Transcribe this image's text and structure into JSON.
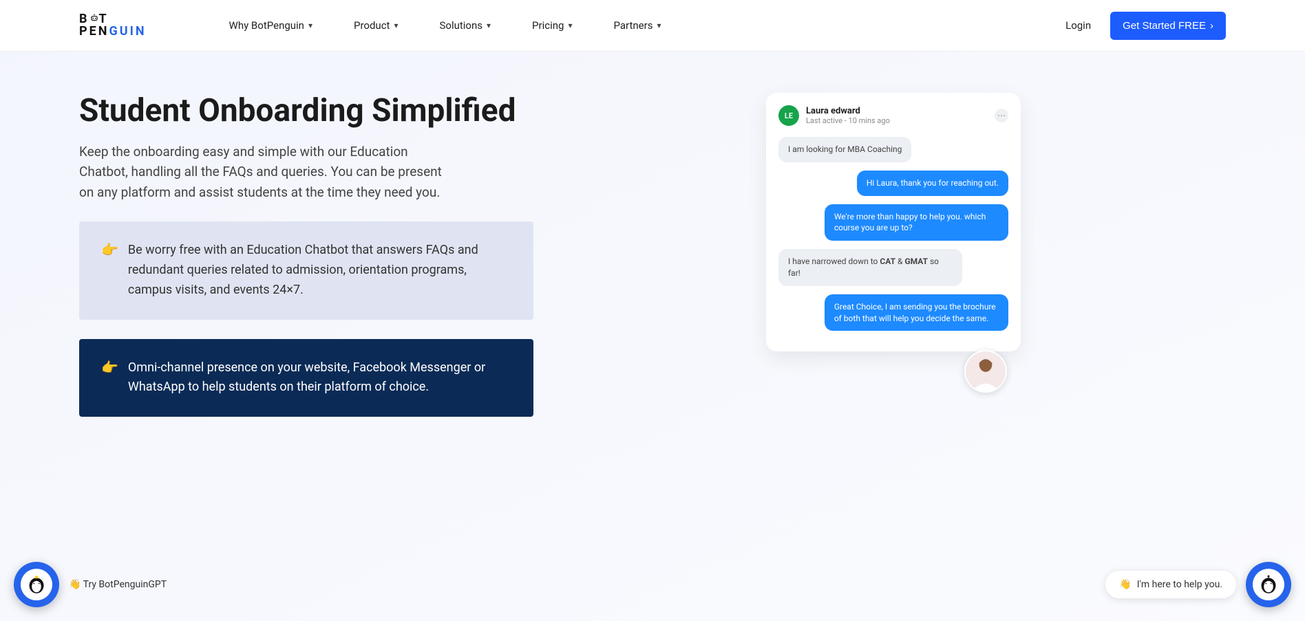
{
  "logo": {
    "line1": "B",
    "line1_end": "T",
    "line2a": "PEN",
    "line2b": "GUIN"
  },
  "nav": {
    "why": "Why BotPenguin",
    "product": "Product",
    "solutions": "Solutions",
    "pricing": "Pricing",
    "partners": "Partners"
  },
  "login": "Login",
  "cta": "Get Started FREE",
  "hero": {
    "title": "Student Onboarding Simplified",
    "subtitle": "Keep the onboarding easy and simple with our Education Chatbot, handling all the FAQs and queries. You can be present on any platform and assist students at the time they need you."
  },
  "cards": {
    "light": "Be worry free with an Education Chatbot that answers FAQs and redundant queries related to admission, orientation programs, campus visits, and events 24×7.",
    "dark": "Omni-channel presence on your website, Facebook Messenger or WhatsApp to help students on their platform of choice."
  },
  "chat": {
    "initials": "LE",
    "name": "Laura edward",
    "status": "Last active - 10 mins ago",
    "m1": "I am looking for MBA Coaching",
    "m2": "Hi Laura, thank you for reaching out.",
    "m3": "We're more than happy to help you. which course you are up to?",
    "m4_a": "I have narrowed down to ",
    "m4_b": "CAT",
    "m4_c": " & ",
    "m4_d": "GMAT",
    "m4_e": " so far!",
    "m5": "Great Choice, I am sending you the brochure of both that will help you decide the same."
  },
  "widgets": {
    "try": "Try BotPenguinGPT",
    "help": "I'm here to help you."
  }
}
